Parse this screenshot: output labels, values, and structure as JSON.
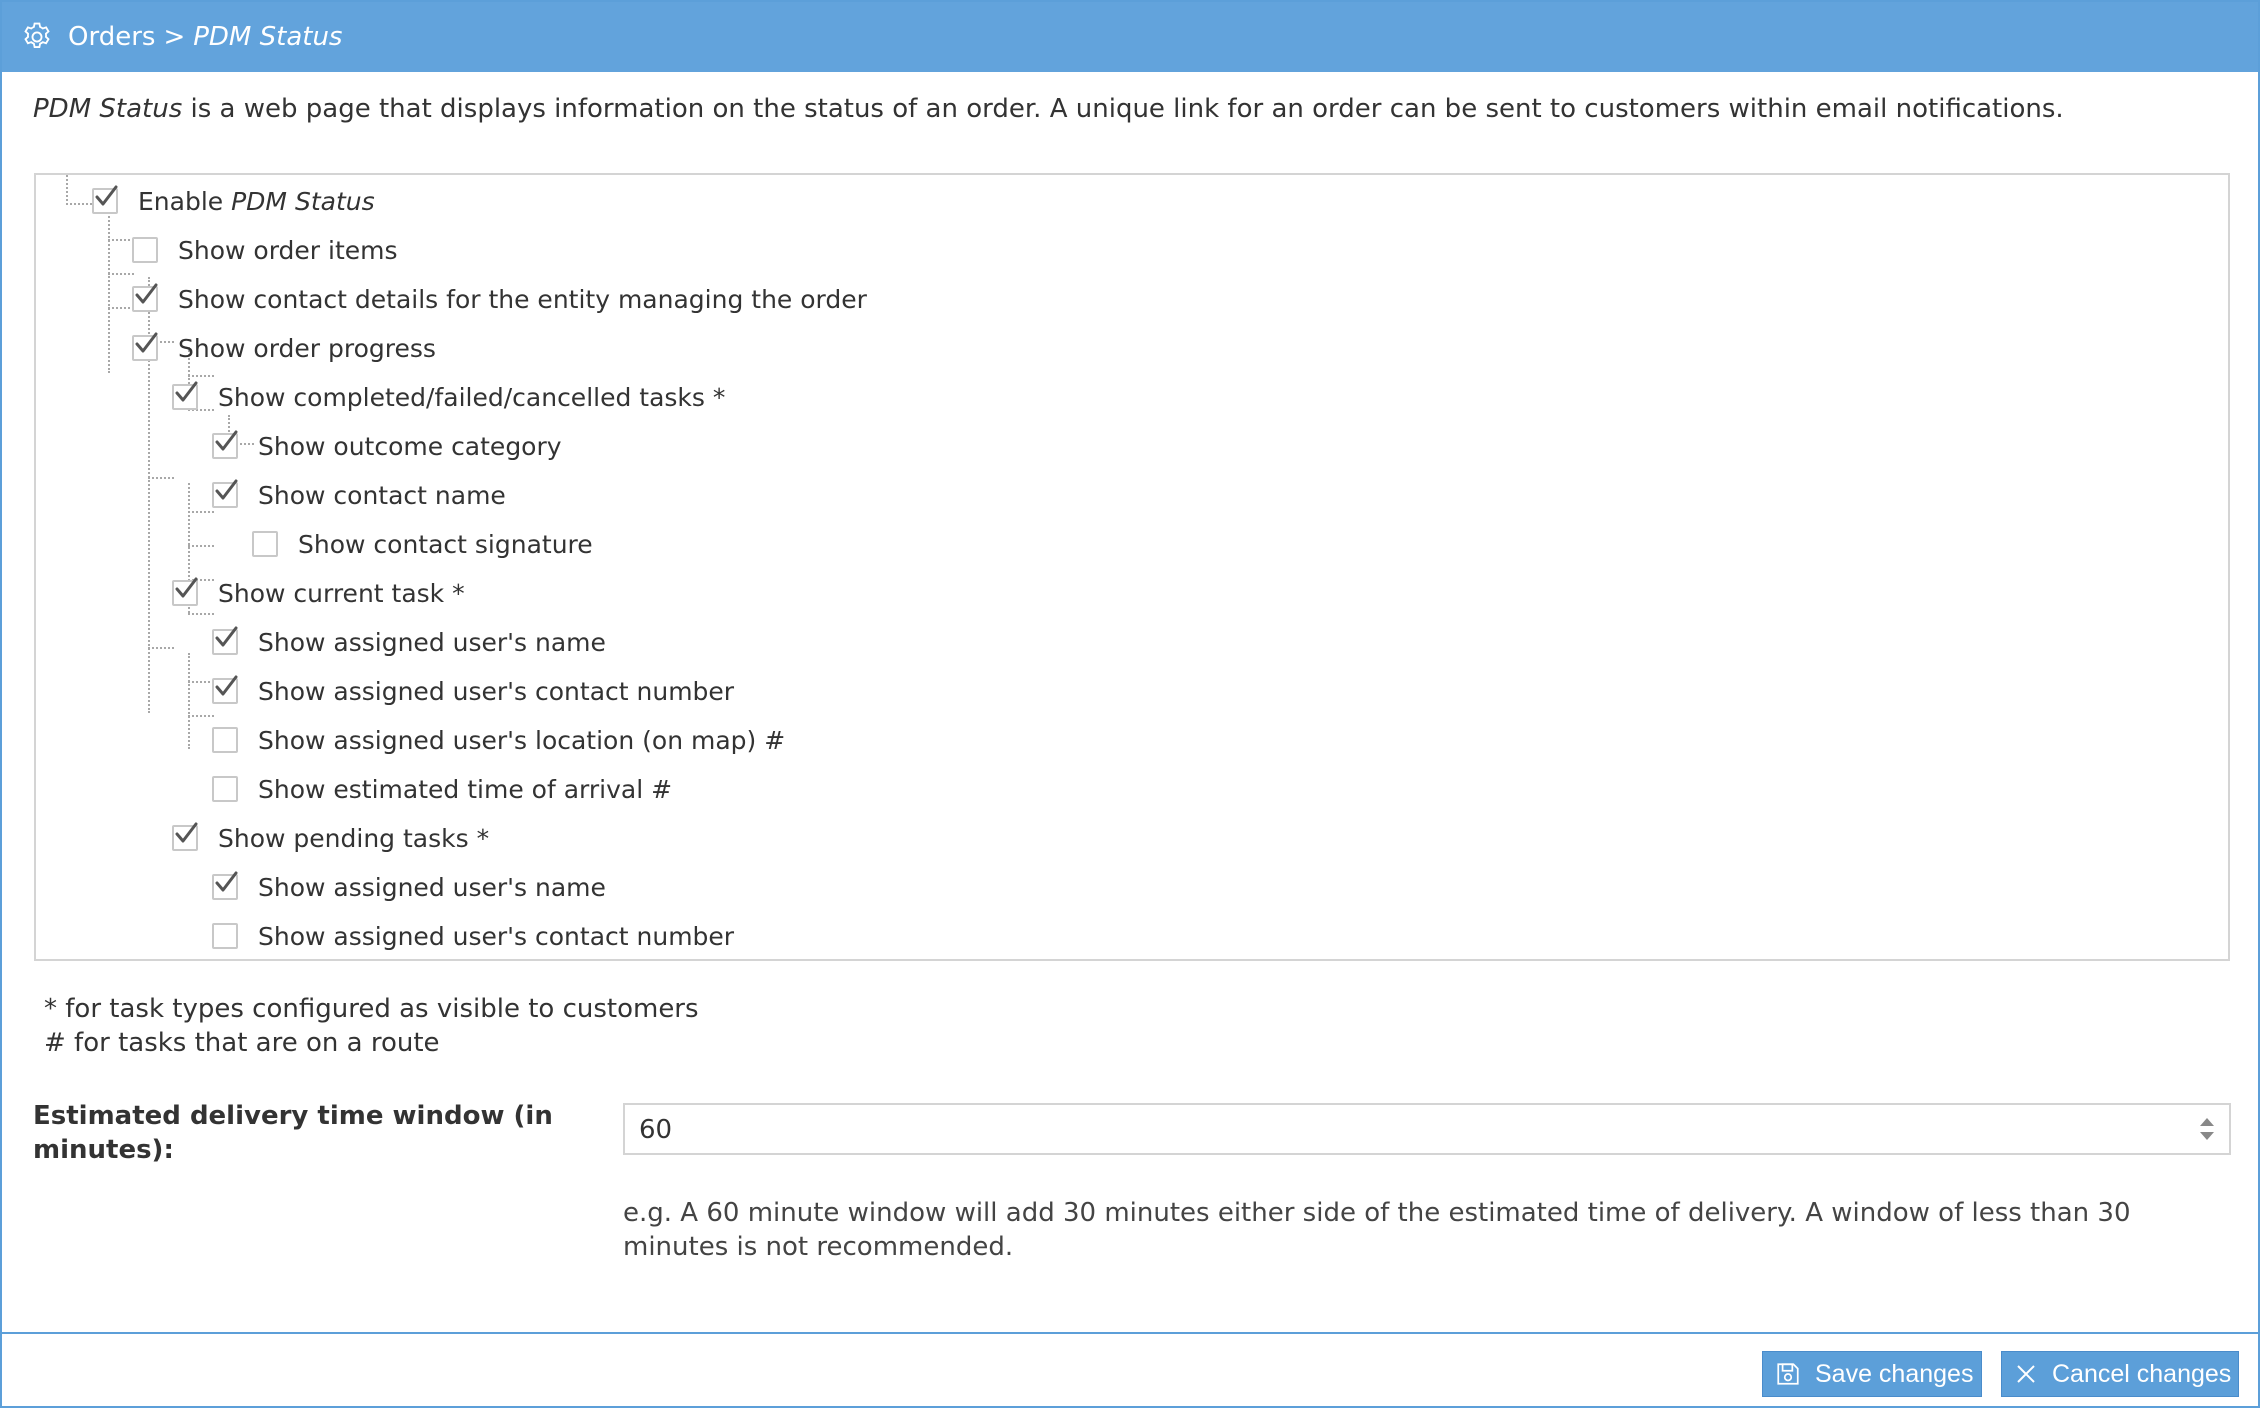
{
  "titlebar": {
    "icon": "gear-icon",
    "breadcrumb_root": "Orders",
    "separator": ">",
    "breadcrumb_current": "PDM Status"
  },
  "intro": {
    "emphasis": "PDM Status",
    "text": " is a web page that displays information on the status of an order. A unique link for an order can be sent to customers within email notifications."
  },
  "tree": [
    {
      "id": "enable",
      "prefix": "Enable ",
      "italic": "PDM Status",
      "label": "",
      "checked": true,
      "level": 0
    },
    {
      "id": "order-items",
      "label": "Show order items",
      "checked": false,
      "level": 1
    },
    {
      "id": "contact-details",
      "label": "Show contact details for the entity managing the order",
      "checked": true,
      "level": 1
    },
    {
      "id": "order-progress",
      "label": "Show order progress",
      "checked": true,
      "level": 1
    },
    {
      "id": "completed-tasks",
      "label": "Show completed/failed/cancelled tasks *",
      "checked": true,
      "level": 2
    },
    {
      "id": "outcome-category",
      "label": "Show outcome category",
      "checked": true,
      "level": 3
    },
    {
      "id": "contact-name",
      "label": "Show contact name",
      "checked": true,
      "level": 3
    },
    {
      "id": "contact-signature",
      "label": "Show contact signature",
      "checked": false,
      "level": 4
    },
    {
      "id": "current-task",
      "label": "Show current task *",
      "checked": true,
      "level": 2
    },
    {
      "id": "current-user-name",
      "label": "Show assigned user's name",
      "checked": true,
      "level": 3
    },
    {
      "id": "current-user-number",
      "label": "Show assigned user's contact number",
      "checked": true,
      "level": 3
    },
    {
      "id": "current-user-location",
      "label": "Show assigned user's location (on map) #",
      "checked": false,
      "level": 3
    },
    {
      "id": "eta",
      "label": "Show estimated time of arrival #",
      "checked": false,
      "level": 3
    },
    {
      "id": "pending-tasks",
      "label": "Show pending tasks *",
      "checked": true,
      "level": 2
    },
    {
      "id": "pending-user-name",
      "label": "Show assigned user's name",
      "checked": true,
      "level": 3
    },
    {
      "id": "pending-user-number",
      "label": "Show assigned user's contact number",
      "checked": false,
      "level": 3
    }
  ],
  "notes": {
    "asterisk": "* for task types configured as visible to customers",
    "hash": "# for tasks that are on a route"
  },
  "delivery_window": {
    "label": "Estimated delivery time window (in minutes):",
    "value": "60",
    "hint": "e.g. A 60 minute window will add 30 minutes either side of the estimated time of delivery. A window of less than 30 minutes is not recommended."
  },
  "footer": {
    "save_label": "Save changes",
    "save_icon": "floppy-disk-icon",
    "cancel_label": "Cancel changes",
    "cancel_icon": "close-icon"
  },
  "colors": {
    "accent": "#62a3dc",
    "button": "#5c9fd9"
  }
}
